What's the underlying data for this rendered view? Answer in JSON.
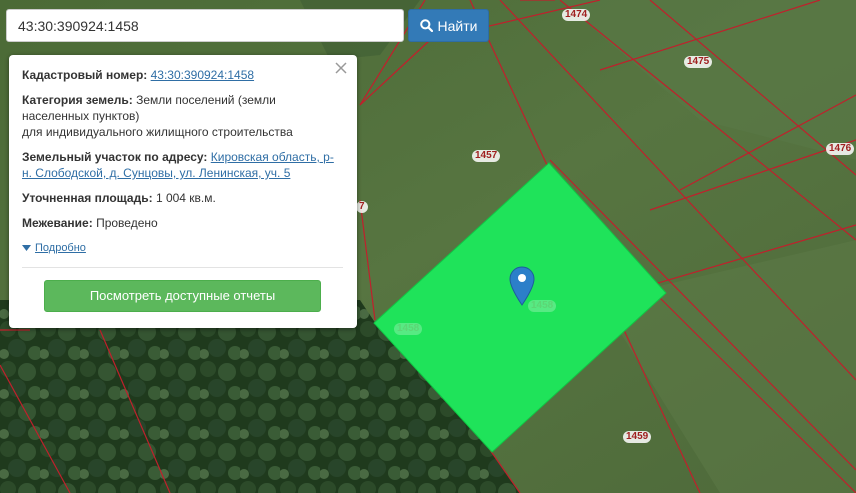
{
  "search": {
    "value": "43:30:390924:1458",
    "button_label": "Найти"
  },
  "popup": {
    "cadastral_label": "Кадастровый номер:",
    "cadastral_value": "43:30:390924:1458",
    "category_label": "Категория земель:",
    "category_value_line1": "Земли поселений (земли населенных пунктов)",
    "category_value_line2": "для индивидуального жилищного строительства",
    "address_label": "Земельный участок по адресу:",
    "address_value": "Кировская область, р-н. Слободской, д. Сунцовы, ул. Ленинская, уч. 5",
    "area_label": "Уточненная площадь:",
    "area_value": "1 004 кв.м.",
    "survey_label": "Межевание:",
    "survey_value": "Проведено",
    "details_link": "Подробно",
    "report_button": "Посмотреть доступные отчеты"
  },
  "map": {
    "plot_labels": [
      "1474",
      "1475",
      "1476",
      "1457",
      "1458",
      "1458",
      "1459",
      "7"
    ],
    "selected_fill": "#1fe35a",
    "boundary_color": "#c0202c"
  }
}
